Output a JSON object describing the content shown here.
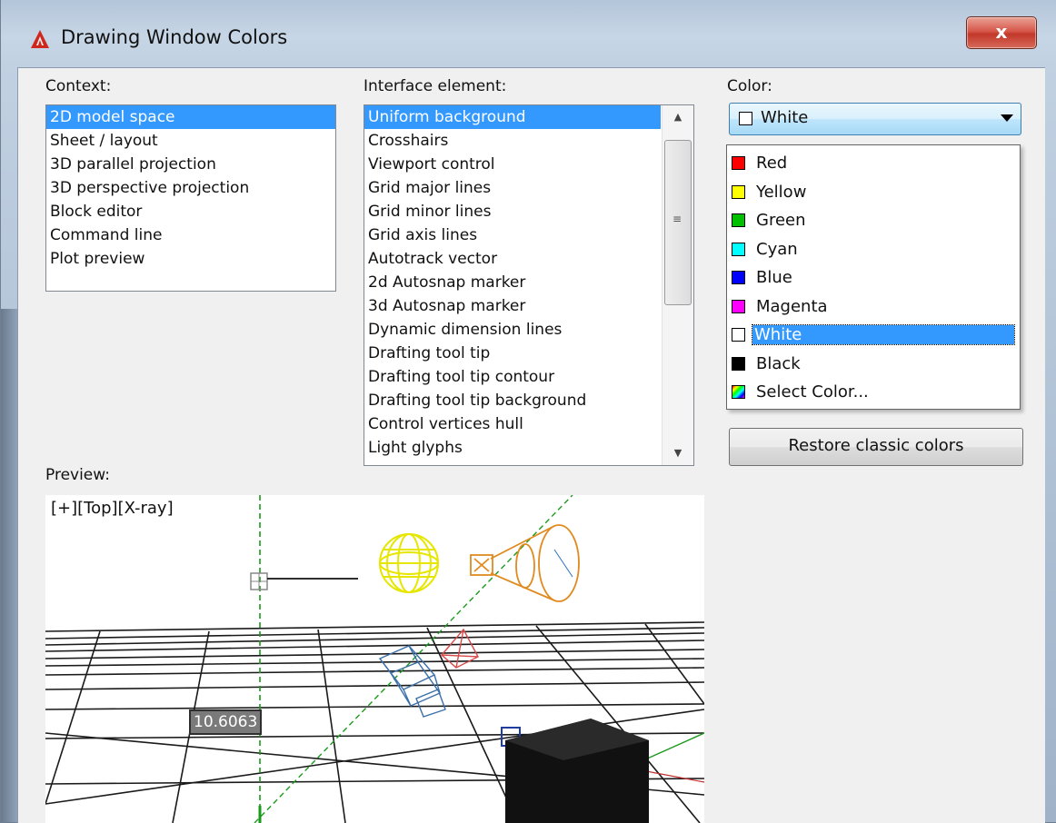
{
  "window": {
    "title": "Drawing Window Colors",
    "close_label": "x"
  },
  "context": {
    "label": "Context:",
    "items": [
      "2D model space",
      "Sheet / layout",
      "3D parallel projection",
      "3D perspective projection",
      "Block editor",
      "Command line",
      "Plot preview"
    ],
    "selected": "2D model space"
  },
  "interface": {
    "label": "Interface element:",
    "items": [
      "Uniform background",
      "Crosshairs",
      "Viewport control",
      "Grid major lines",
      "Grid minor lines",
      "Grid axis lines",
      "Autotrack vector",
      "2d Autosnap marker",
      "3d Autosnap marker",
      "Dynamic dimension lines",
      "Drafting tool tip",
      "Drafting tool tip contour",
      "Drafting tool tip background",
      "Control vertices hull",
      "Light glyphs"
    ],
    "selected": "Uniform background"
  },
  "color": {
    "label": "Color:",
    "current": "White",
    "current_swatch": "#ffffff",
    "options": [
      {
        "label": "Red",
        "swatch": "#ff0000"
      },
      {
        "label": "Yellow",
        "swatch": "#ffff00"
      },
      {
        "label": "Green",
        "swatch": "#00c000"
      },
      {
        "label": "Cyan",
        "swatch": "#00ffff"
      },
      {
        "label": "Blue",
        "swatch": "#0000ff"
      },
      {
        "label": "Magenta",
        "swatch": "#ff00ff"
      },
      {
        "label": "White",
        "swatch": "#ffffff"
      },
      {
        "label": "Black",
        "swatch": "#000000"
      },
      {
        "label": "Select Color...",
        "swatch": "spectrum"
      }
    ],
    "highlighted": "White"
  },
  "restore_button": "Restore classic colors",
  "preview": {
    "label": "Preview:",
    "viewport_label": "[+][Top][X-ray]",
    "dimension_value": "10.6063"
  }
}
